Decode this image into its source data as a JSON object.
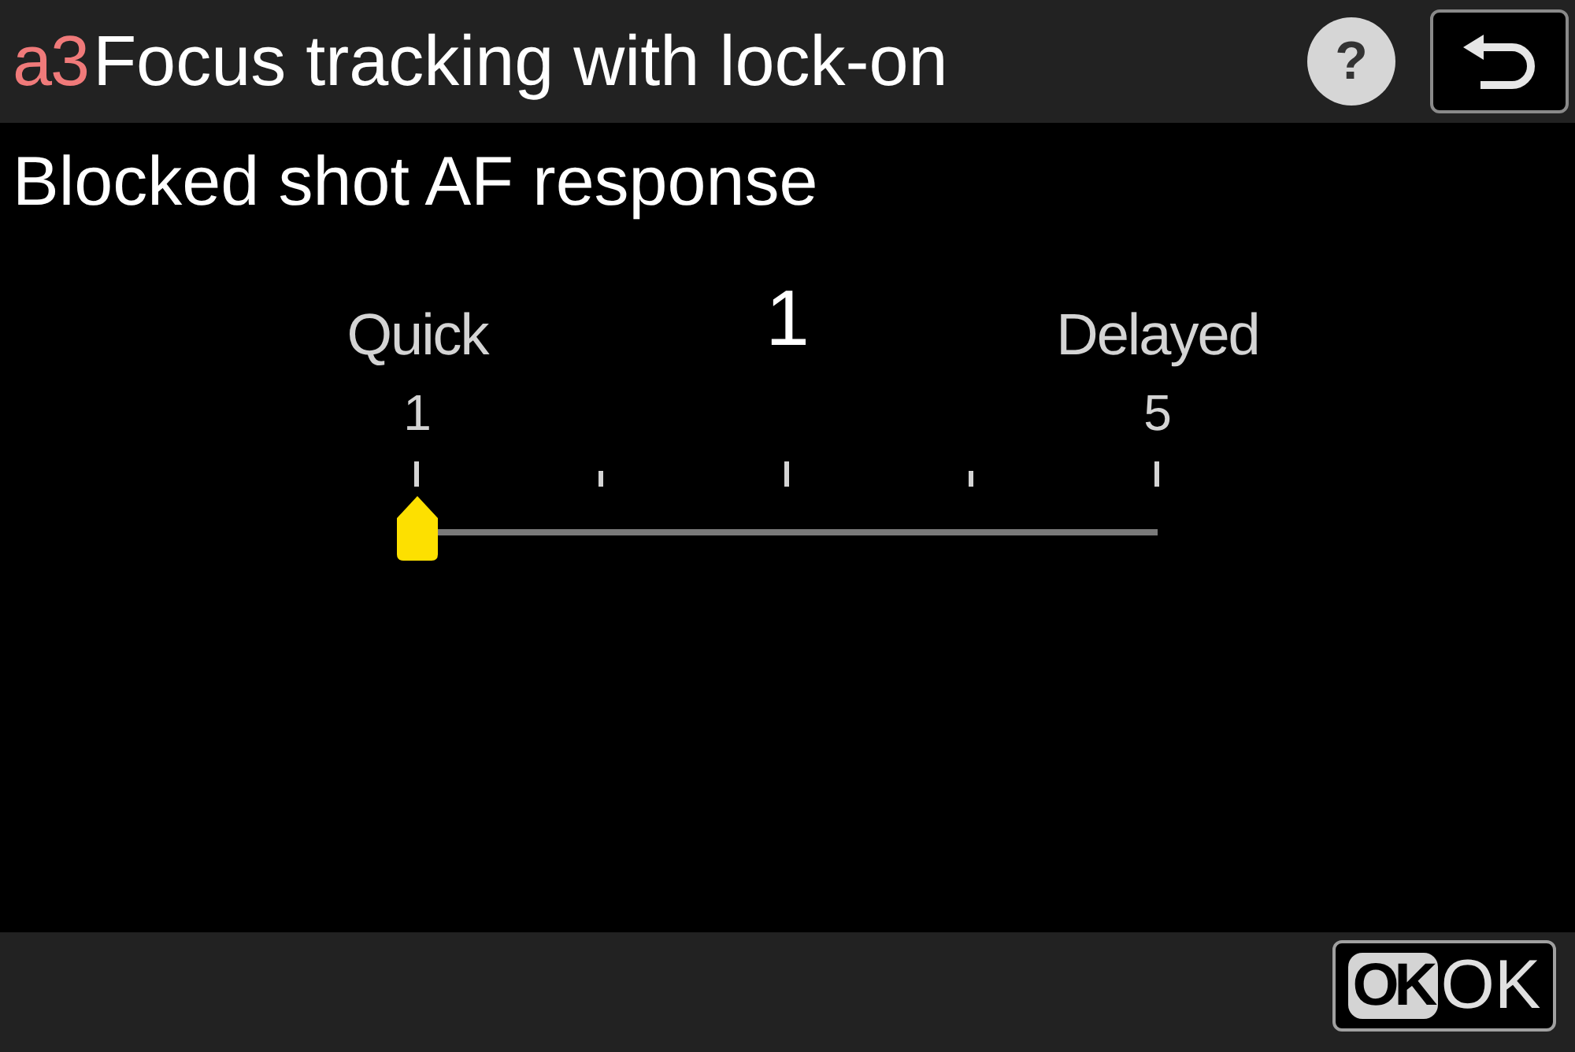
{
  "header": {
    "code": "a3",
    "title": "Focus tracking with lock-on",
    "help_button": "?"
  },
  "setting": {
    "title": "Blocked shot AF response"
  },
  "slider": {
    "value": "1",
    "min_label": "Quick",
    "max_label": "Delayed",
    "min_number": "1",
    "max_number": "5",
    "level": 0
  },
  "footer": {
    "ok_button": {
      "key": "OK",
      "label": "OK"
    }
  }
}
